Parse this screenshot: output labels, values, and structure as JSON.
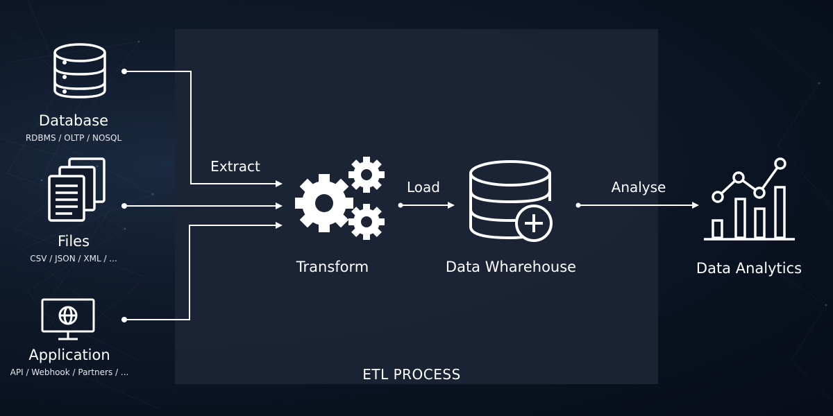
{
  "sources": {
    "database": {
      "title": "Database",
      "subtitle": "RDBMS / OLTP / NOSQL"
    },
    "files": {
      "title": "Files",
      "subtitle": "CSV / JSON / XML / ..."
    },
    "application": {
      "title": "Application",
      "subtitle": "API / Webhook / Partners / ..."
    }
  },
  "edges": {
    "extract": "Extract",
    "load": "Load",
    "analyse": "Analyse"
  },
  "stages": {
    "transform": "Transform",
    "warehouse": "Data Wharehouse",
    "analytics": "Data Analytics"
  },
  "etl_caption": "ETL PROCESS",
  "colors": {
    "background": "#0a1220",
    "etl_box": "#1c2535",
    "line": "#ffffff"
  }
}
